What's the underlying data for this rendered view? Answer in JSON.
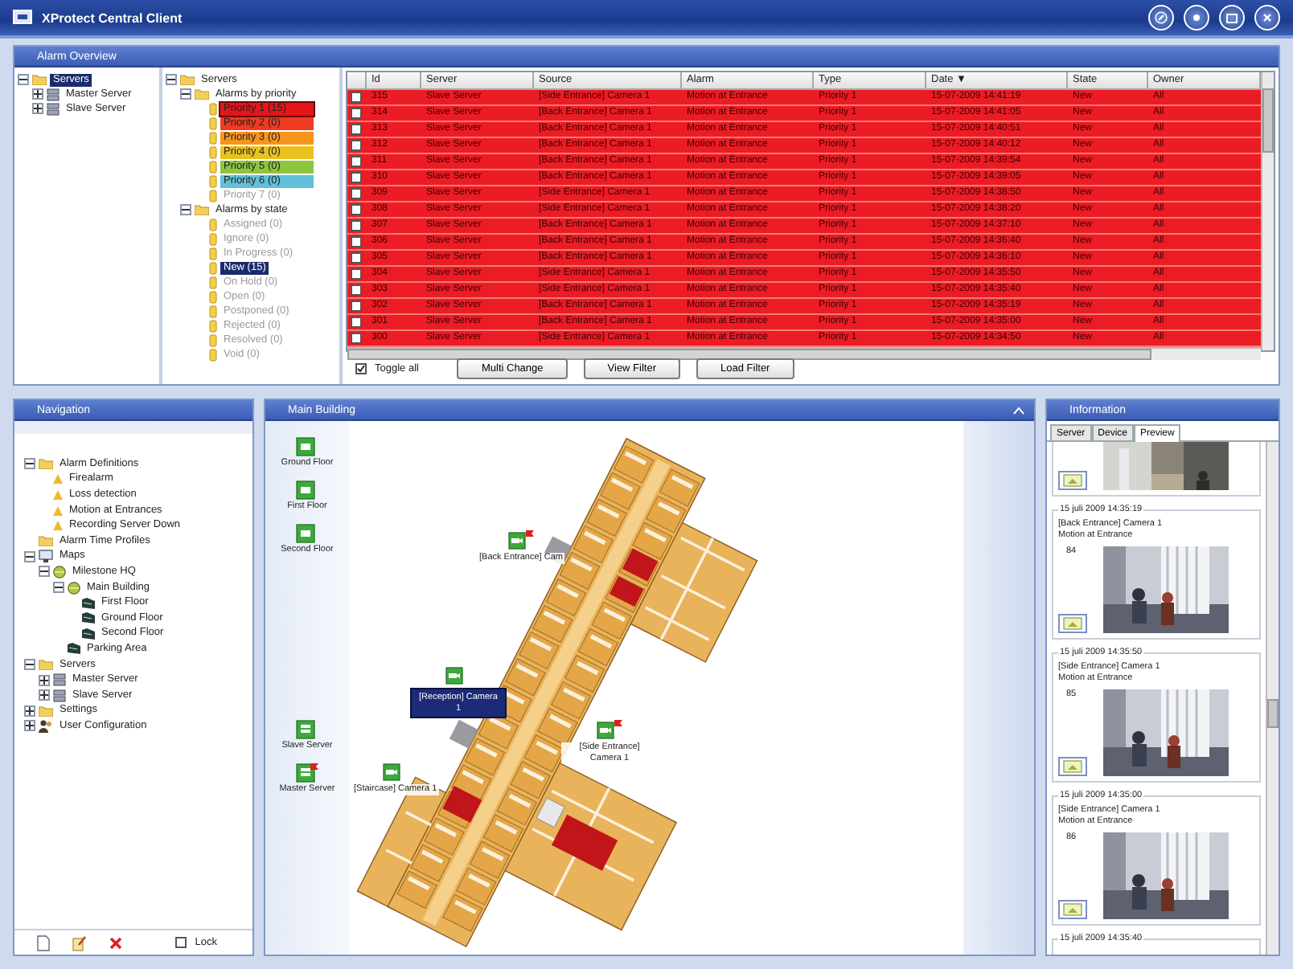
{
  "window": {
    "title": "XProtect Central Client"
  },
  "alarm_overview": {
    "title": "Alarm Overview",
    "server_tree": [
      {
        "label": "Servers",
        "kind": "folder",
        "expanded": true,
        "selected": true,
        "children": [
          {
            "label": "Master Server",
            "kind": "server",
            "expanded": false,
            "selected": false
          },
          {
            "label": "Slave Server",
            "kind": "server",
            "expanded": false,
            "selected": false
          }
        ]
      }
    ],
    "filter_tree": [
      {
        "label": "Servers",
        "kind": "folder",
        "expanded": true,
        "selected": false,
        "disabled": false,
        "children": [
          {
            "label": "Alarms by priority",
            "kind": "folder",
            "expanded": true,
            "selected": false,
            "disabled": false,
            "children": [
              {
                "label": "Priority 1 (15)",
                "kind": "tag",
                "color": "#e3161b",
                "selected": true,
                "disabled": false
              },
              {
                "label": "Priority 2 (0)",
                "kind": "tag",
                "color": "#ee3b22",
                "selected": false,
                "disabled": false
              },
              {
                "label": "Priority 3 (0)",
                "kind": "tag",
                "color": "#f7941d",
                "selected": false,
                "disabled": false
              },
              {
                "label": "Priority 4 (0)",
                "kind": "tag",
                "color": "#e9c21f",
                "selected": false,
                "disabled": false
              },
              {
                "label": "Priority 5 (0)",
                "kind": "tag",
                "color": "#8cc63f",
                "selected": false,
                "disabled": false
              },
              {
                "label": "Priority 6 (0)",
                "kind": "tag",
                "color": "#62c0d8",
                "selected": false,
                "disabled": false
              },
              {
                "label": "Priority 7 (0)",
                "kind": "tag",
                "selected": false,
                "disabled": true
              }
            ]
          },
          {
            "label": "Alarms by state",
            "kind": "folder",
            "expanded": true,
            "selected": false,
            "disabled": false,
            "children": [
              {
                "label": "Assigned (0)",
                "kind": "tag",
                "selected": false,
                "disabled": true
              },
              {
                "label": "Ignore (0)",
                "kind": "tag",
                "selected": false,
                "disabled": true
              },
              {
                "label": "In Progress (0)",
                "kind": "tag",
                "selected": false,
                "disabled": true
              },
              {
                "label": "New (15)",
                "kind": "tag",
                "selected": true,
                "disabled": false
              },
              {
                "label": "On Hold (0)",
                "kind": "tag",
                "selected": false,
                "disabled": true
              },
              {
                "label": "Open (0)",
                "kind": "tag",
                "selected": false,
                "disabled": true
              },
              {
                "label": "Postponed (0)",
                "kind": "tag",
                "selected": false,
                "disabled": true
              },
              {
                "label": "Rejected (0)",
                "kind": "tag",
                "selected": false,
                "disabled": true
              },
              {
                "label": "Resolved (0)",
                "kind": "tag",
                "selected": false,
                "disabled": true
              },
              {
                "label": "Void (0)",
                "kind": "tag",
                "selected": false,
                "disabled": true
              }
            ]
          }
        ]
      }
    ],
    "columns": [
      "Id",
      "Server",
      "Source",
      "Alarm",
      "Type",
      "Date ▼",
      "State",
      "Owner"
    ],
    "rows": [
      {
        "checked": false,
        "cells": [
          "315",
          "Slave Server",
          "[Side Entrance] Camera 1",
          "Motion at Entrance",
          "Priority 1",
          "15-07-2009 14:41:19",
          "New",
          "All"
        ]
      },
      {
        "checked": false,
        "cells": [
          "314",
          "Slave Server",
          "[Back Entrance] Camera 1",
          "Motion at Entrance",
          "Priority 1",
          "15-07-2009 14:41:05",
          "New",
          "All"
        ]
      },
      {
        "checked": false,
        "cells": [
          "313",
          "Slave Server",
          "[Back Entrance] Camera 1",
          "Motion at Entrance",
          "Priority 1",
          "15-07-2009 14:40:51",
          "New",
          "All"
        ]
      },
      {
        "checked": false,
        "cells": [
          "312",
          "Slave Server",
          "[Back Entrance] Camera 1",
          "Motion at Entrance",
          "Priority 1",
          "15-07-2009 14:40:12",
          "New",
          "All"
        ]
      },
      {
        "checked": false,
        "cells": [
          "311",
          "Slave Server",
          "[Back Entrance] Camera 1",
          "Motion at Entrance",
          "Priority 1",
          "15-07-2009 14:39:54",
          "New",
          "All"
        ]
      },
      {
        "checked": false,
        "cells": [
          "310",
          "Slave Server",
          "[Back Entrance] Camera 1",
          "Motion at Entrance",
          "Priority 1",
          "15-07-2009 14:39:05",
          "New",
          "All"
        ]
      },
      {
        "checked": false,
        "cells": [
          "309",
          "Slave Server",
          "[Side Entrance] Camera 1",
          "Motion at Entrance",
          "Priority 1",
          "15-07-2009 14:38:50",
          "New",
          "All"
        ]
      },
      {
        "checked": false,
        "cells": [
          "308",
          "Slave Server",
          "[Side Entrance] Camera 1",
          "Motion at Entrance",
          "Priority 1",
          "15-07-2009 14:38:20",
          "New",
          "All"
        ]
      },
      {
        "checked": false,
        "cells": [
          "307",
          "Slave Server",
          "[Back Entrance] Camera 1",
          "Motion at Entrance",
          "Priority 1",
          "15-07-2009 14:37:10",
          "New",
          "All"
        ]
      },
      {
        "checked": false,
        "cells": [
          "306",
          "Slave Server",
          "[Back Entrance] Camera 1",
          "Motion at Entrance",
          "Priority 1",
          "15-07-2009 14:36:40",
          "New",
          "All"
        ]
      },
      {
        "checked": false,
        "cells": [
          "305",
          "Slave Server",
          "[Back Entrance] Camera 1",
          "Motion at Entrance",
          "Priority 1",
          "15-07-2009 14:36:10",
          "New",
          "All"
        ]
      },
      {
        "checked": false,
        "cells": [
          "304",
          "Slave Server",
          "[Side Entrance] Camera 1",
          "Motion at Entrance",
          "Priority 1",
          "15-07-2009 14:35:50",
          "New",
          "All"
        ]
      },
      {
        "checked": false,
        "cells": [
          "303",
          "Slave Server",
          "[Side Entrance] Camera 1",
          "Motion at Entrance",
          "Priority 1",
          "15-07-2009 14:35:40",
          "New",
          "All"
        ]
      },
      {
        "checked": false,
        "cells": [
          "302",
          "Slave Server",
          "[Back Entrance] Camera 1",
          "Motion at Entrance",
          "Priority 1",
          "15-07-2009 14:35:19",
          "New",
          "All"
        ]
      },
      {
        "checked": false,
        "cells": [
          "301",
          "Slave Server",
          "[Back Entrance] Camera 1",
          "Motion at Entrance",
          "Priority 1",
          "15-07-2009 14:35:00",
          "New",
          "All"
        ]
      },
      {
        "checked": false,
        "cells": [
          "300",
          "Slave Server",
          "[Side Entrance] Camera 1",
          "Motion at Entrance",
          "Priority 1",
          "15-07-2009 14:34:50",
          "New",
          "All"
        ]
      }
    ],
    "toggle_all": {
      "label": "Toggle all",
      "checked": true
    },
    "buttons": [
      "Multi Change",
      "View Filter",
      "Load Filter"
    ]
  },
  "navigation": {
    "title": "Navigation",
    "tree": [
      {
        "label": "Alarm Definitions",
        "kind": "folder",
        "expanded": true,
        "children": [
          {
            "label": "Firealarm",
            "kind": "alarm"
          },
          {
            "label": "Loss detection",
            "kind": "alarm"
          },
          {
            "label": "Motion at Entrances",
            "kind": "alarm"
          },
          {
            "label": "Recording Server Down",
            "kind": "alarm"
          }
        ]
      },
      {
        "label": "Alarm Time Profiles",
        "kind": "folder"
      },
      {
        "label": "Maps",
        "kind": "map",
        "expanded": true,
        "children": [
          {
            "label": "Milestone HQ",
            "kind": "site",
            "expanded": true,
            "children": [
              {
                "label": "Main Building",
                "kind": "site",
                "expanded": true,
                "children": [
                  {
                    "label": "First Floor",
                    "kind": "floor"
                  },
                  {
                    "label": "Ground Floor",
                    "kind": "floor"
                  },
                  {
                    "label": "Second Floor",
                    "kind": "floor"
                  }
                ]
              },
              {
                "label": "Parking Area",
                "kind": "floor"
              }
            ]
          }
        ]
      },
      {
        "label": "Servers",
        "kind": "folder",
        "expanded": true,
        "children": [
          {
            "label": "Master Server",
            "kind": "server",
            "expanded": false
          },
          {
            "label": "Slave Server",
            "kind": "server",
            "expanded": false
          }
        ]
      },
      {
        "label": "Settings",
        "kind": "folder",
        "expanded": false
      },
      {
        "label": "User Configuration",
        "kind": "users",
        "expanded": false
      }
    ],
    "lock": {
      "label": "Lock",
      "checked": false
    }
  },
  "map": {
    "title": "Main Building",
    "links": [
      {
        "label": "Ground Floor",
        "kind": "floor",
        "alarm": false
      },
      {
        "label": "First Floor",
        "kind": "floor",
        "alarm": false
      },
      {
        "label": "Second Floor",
        "kind": "floor",
        "alarm": false
      },
      {
        "label": "Slave Server",
        "kind": "server",
        "alarm": false
      },
      {
        "label": "Master Server",
        "kind": "server",
        "alarm": true
      }
    ],
    "cameras": [
      {
        "label": "[Back Entrance] Cam",
        "selected": false,
        "alarm": true
      },
      {
        "label": "[Reception] Camera 1",
        "selected": true,
        "alarm": false
      },
      {
        "label": "[Side Entrance] Camera 1",
        "selected": false,
        "alarm": true
      },
      {
        "label": "[Staircase] Camera 1",
        "selected": false,
        "alarm": false
      }
    ]
  },
  "information": {
    "title": "Information",
    "tabs": [
      {
        "label": "Server",
        "selected": false
      },
      {
        "label": "Device",
        "selected": false
      },
      {
        "label": "Preview",
        "selected": true
      }
    ],
    "cards": [
      {
        "kind": "cropped"
      },
      {
        "kind": "full",
        "time": "15 juli 2009 14:35:19",
        "source": "[Back Entrance] Camera 1",
        "alarm": "Motion at Entrance",
        "id": "84"
      },
      {
        "kind": "full",
        "time": "15 juli 2009 14:35:50",
        "source": "[Side Entrance] Camera 1",
        "alarm": "Motion at Entrance",
        "id": "85"
      },
      {
        "kind": "full",
        "time": "15 juli 2009 14:35:00",
        "source": "[Side Entrance] Camera 1",
        "alarm": "Motion at Entrance",
        "id": "86"
      },
      {
        "kind": "header",
        "time": "15 juli 2009 14:35:40"
      }
    ]
  }
}
